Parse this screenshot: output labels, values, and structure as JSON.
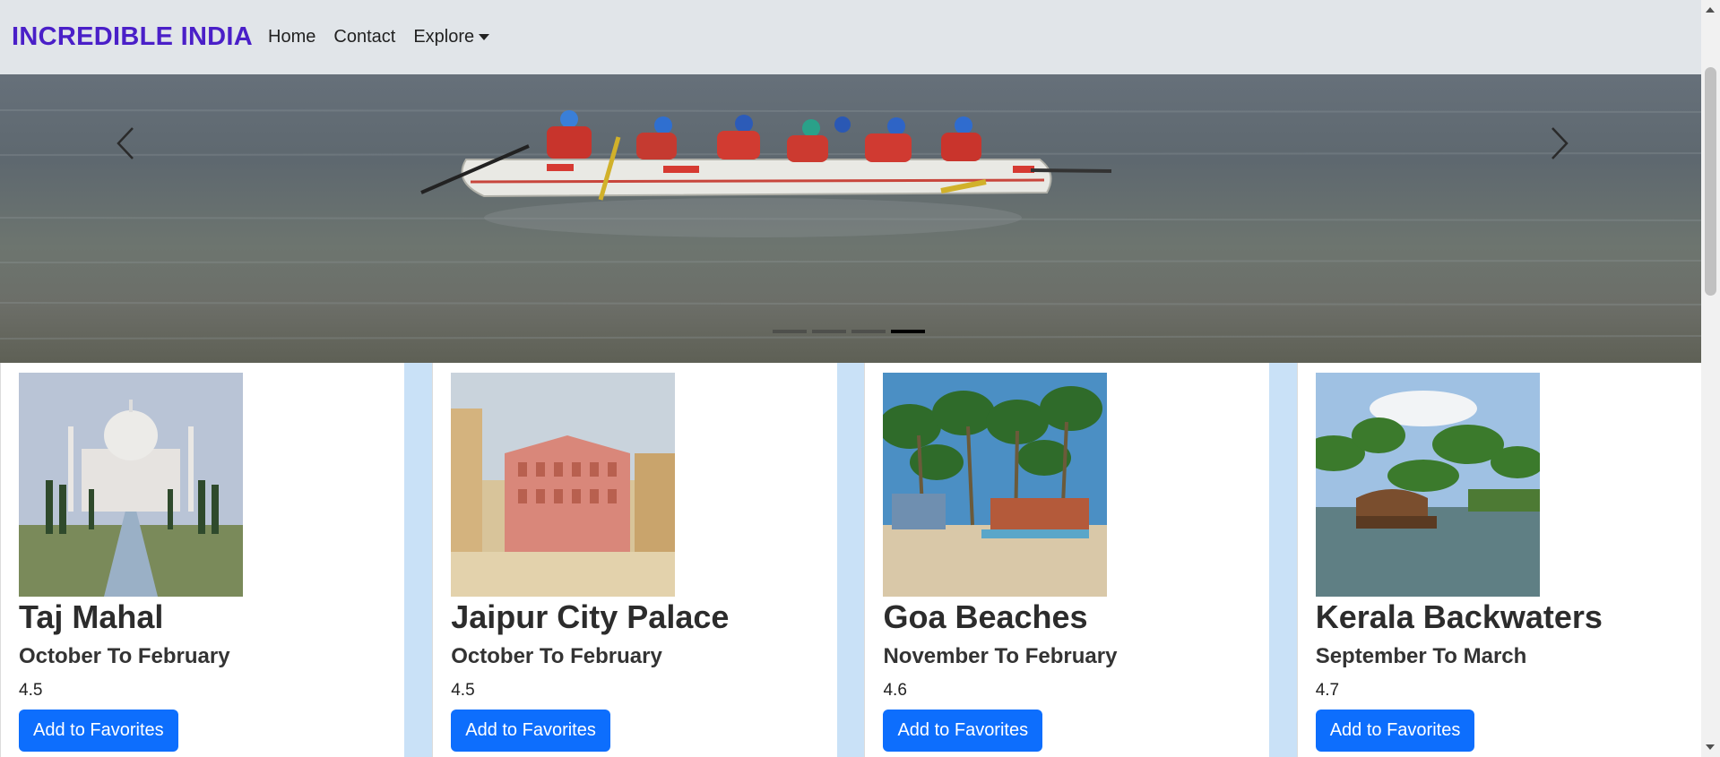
{
  "navbar": {
    "brand": "INCREDIBLE INDIA",
    "links": [
      {
        "label": "Home"
      },
      {
        "label": "Contact"
      },
      {
        "label": "Explore"
      }
    ]
  },
  "carousel": {
    "slide_count": 4,
    "active_index": 3,
    "prev_icon": "chevron-left-icon",
    "next_icon": "chevron-right-icon"
  },
  "destinations": [
    {
      "name": "Taj Mahal",
      "season": "October To February",
      "rating": "4.5",
      "button": "Add to Favorites"
    },
    {
      "name": "Jaipur City Palace",
      "season": "October To February",
      "rating": "4.5",
      "button": "Add to Favorites"
    },
    {
      "name": "Goa Beaches",
      "season": "November To February",
      "rating": "4.6",
      "button": "Add to Favorites"
    },
    {
      "name": "Kerala Backwaters",
      "season": "September To March",
      "rating": "4.7",
      "button": "Add to Favorites"
    }
  ],
  "colors": {
    "brand": "#4a1fc8",
    "navbar_bg": "#e1e5e9",
    "button_primary": "#0d6efd",
    "gutter": "#c9e1f7"
  }
}
